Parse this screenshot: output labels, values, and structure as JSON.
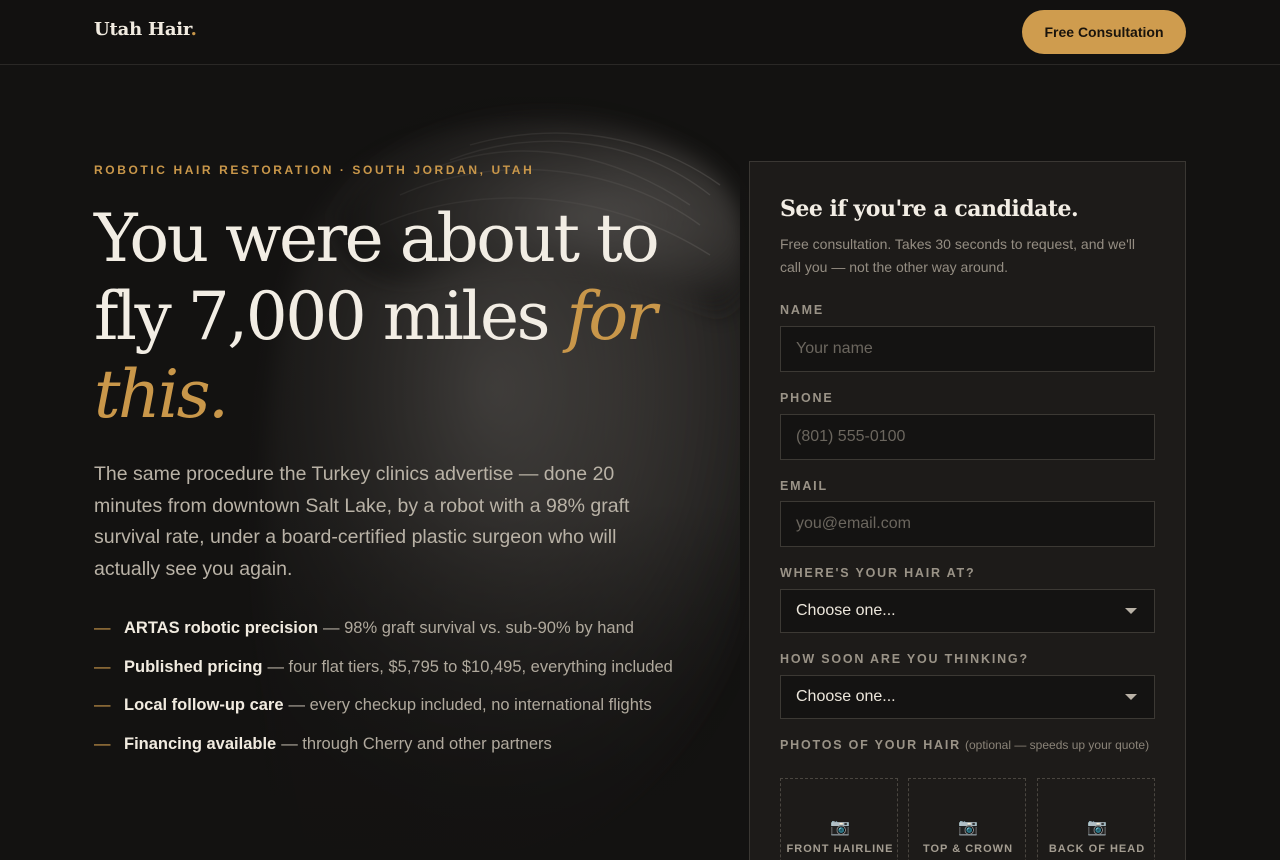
{
  "header": {
    "logo_text": "Utah Hair",
    "logo_dot": ".",
    "cta_label": "Free Consultation"
  },
  "hero": {
    "eyebrow": "ROBOTIC HAIR RESTORATION · SOUTH JORDAN, UTAH",
    "headline_main": "You were about to fly 7,000 miles ",
    "headline_accent": "for this.",
    "lede": "The same procedure the Turkey clinics advertise — done 20 minutes from downtown Salt Lake, by a robot with a 98% graft survival rate, under a board-certified plastic surgeon who will actually see you again.",
    "bullet_marker": "—",
    "benefits": [
      {
        "title": "ARTAS robotic precision",
        "text": "— 98% graft survival vs. sub-90% by hand"
      },
      {
        "title": "Published pricing",
        "text": "— four flat tiers, $5,795 to $10,495, everything included"
      },
      {
        "title": "Local follow-up care",
        "text": "— every checkup included, no international flights"
      },
      {
        "title": "Financing available",
        "text": "— through Cherry and other partners"
      }
    ]
  },
  "form": {
    "title": "See if you're a candidate.",
    "subtitle": "Free consultation. Takes 30 seconds to request, and we'll call you — not the other way around.",
    "name_label": "NAME",
    "name_placeholder": "Your name",
    "phone_label": "PHONE",
    "phone_placeholder": "(801) 555-0100",
    "email_label": "EMAIL",
    "email_placeholder": "you@email.com",
    "hair_label": "WHERE'S YOUR HAIR AT?",
    "hair_value": "Choose one...",
    "timing_label": "HOW SOON ARE YOU THINKING?",
    "timing_value": "Choose one...",
    "photos_label": "PHOTOS OF YOUR HAIR",
    "photos_optional": "(optional — speeds up your quote)",
    "photo_icon": "📷",
    "photo_tiles": [
      "FRONT HAIRLINE",
      "TOP & CROWN",
      "BACK OF HEAD"
    ]
  },
  "colors": {
    "accent": "#c9974a",
    "background": "#131211",
    "card": "#1d1b19"
  }
}
